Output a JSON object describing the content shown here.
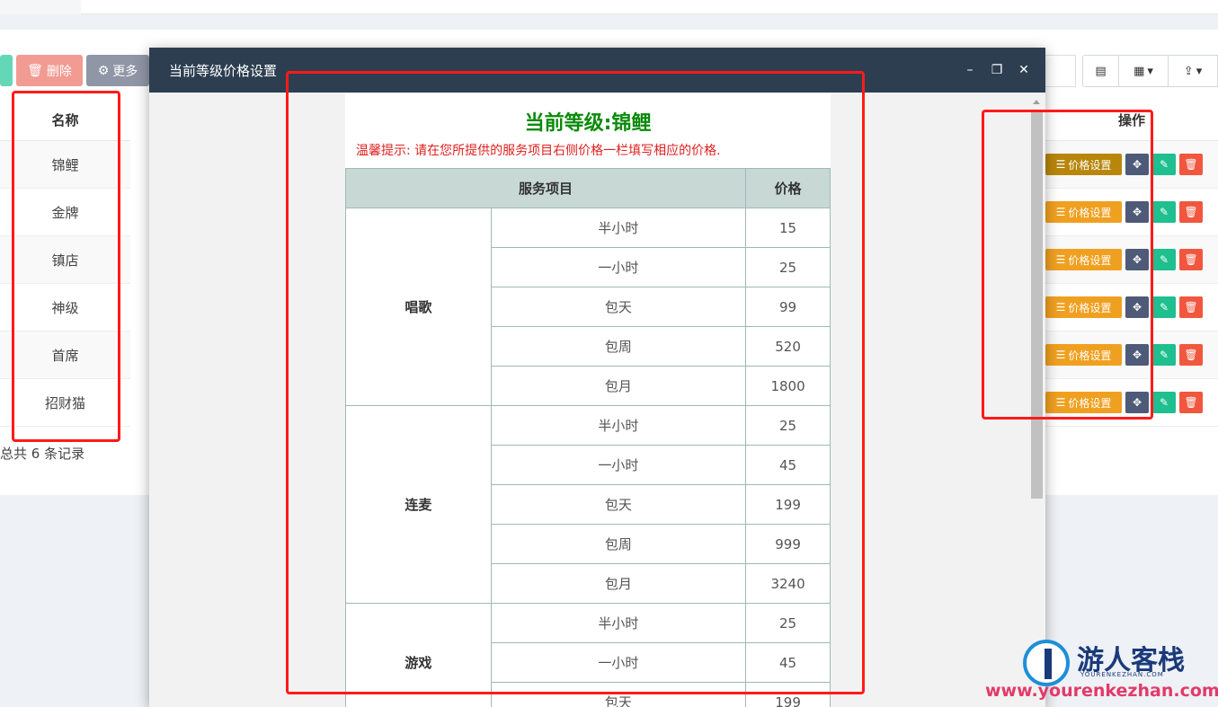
{
  "toolbar": {
    "delete_label": "删除",
    "more_label": "更多"
  },
  "list": {
    "name_header": "名称",
    "action_header": "操作",
    "rows": [
      "锦鲤",
      "金牌",
      "镇店",
      "神级",
      "首席",
      "招财猫"
    ],
    "price_button_label": "价格设置",
    "record_count": "总共 6 条记录"
  },
  "modal": {
    "title": "当前等级价格设置",
    "level_heading": "当前等级:锦鲤",
    "tip": "温馨提示: 请在您所提供的服务项目右侧价格一栏填写相应的价格.",
    "col_service": "服务项目",
    "col_price": "价格",
    "groups": [
      {
        "name": "唱歌",
        "items": [
          {
            "label": "半小时",
            "price": "15"
          },
          {
            "label": "一小时",
            "price": "25"
          },
          {
            "label": "包天",
            "price": "99"
          },
          {
            "label": "包周",
            "price": "520"
          },
          {
            "label": "包月",
            "price": "1800"
          }
        ]
      },
      {
        "name": "连麦",
        "items": [
          {
            "label": "半小时",
            "price": "25"
          },
          {
            "label": "一小时",
            "price": "45"
          },
          {
            "label": "包天",
            "price": "199"
          },
          {
            "label": "包周",
            "price": "999"
          },
          {
            "label": "包月",
            "price": "3240"
          }
        ]
      },
      {
        "name": "游戏",
        "items": [
          {
            "label": "半小时",
            "price": "25"
          },
          {
            "label": "一小时",
            "price": "45"
          },
          {
            "label": "包天",
            "price": "199"
          }
        ]
      }
    ]
  },
  "watermark": {
    "brand": "游人客栈",
    "sub": "YOURENKEZHAN.COM",
    "url": "www.yourenkezhan.com"
  },
  "colors": {
    "modal_header": "#2c3e50",
    "level_heading": "#0a8a0a",
    "tip": "#e02020",
    "price_button": "#f0a020",
    "annotation": "#ff1a1a"
  }
}
